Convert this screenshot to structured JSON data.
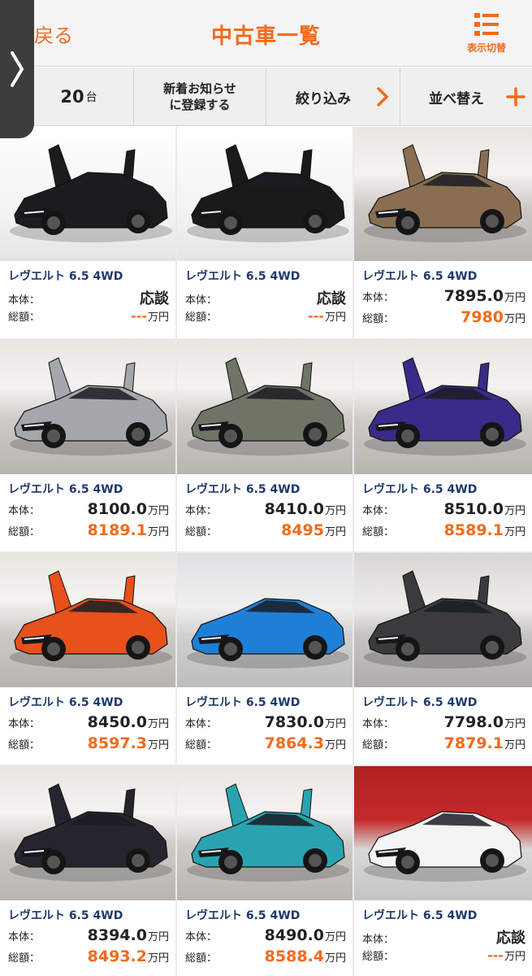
{
  "header": {
    "back_label": "戻る",
    "title": "中古車一覧",
    "view_toggle_label": "表示切替",
    "accent": "#f26a1b"
  },
  "toolbar": {
    "count_value": "20",
    "count_unit": "台",
    "notify_line1": "新着お知らせ",
    "notify_line2": "に登録する",
    "filter_label": "絞り込み",
    "sort_label": "並べ替え"
  },
  "labels": {
    "body": "本体：",
    "total": "総額：",
    "yen": "万円"
  },
  "cars": [
    {
      "model": "レヴエルト 6.5 4WD",
      "body_price": "応談",
      "total_price": "---",
      "color": "#1c1c1e",
      "bg": "white"
    },
    {
      "model": "レヴエルト 6.5 4WD",
      "body_price": "応談",
      "total_price": "---",
      "color": "#1a1a1a",
      "bg": "white"
    },
    {
      "model": "レヴエルト 6.5 4WD",
      "body_price": "7895.0",
      "total_price": "7980",
      "color": "#8a6e52",
      "bg": "showroom"
    },
    {
      "model": "レヴエルト 6.5 4WD",
      "body_price": "8100.0",
      "total_price": "8189.1",
      "color": "#a4a7ab",
      "bg": "showroom"
    },
    {
      "model": "レヴエルト 6.5 4WD",
      "body_price": "8410.0",
      "total_price": "8495",
      "color": "#6e7566",
      "bg": "showroom"
    },
    {
      "model": "レヴエルト 6.5 4WD",
      "body_price": "8510.0",
      "total_price": "8589.1",
      "color": "#3a2a8a",
      "bg": "showroom"
    },
    {
      "model": "レヴエルト 6.5 4WD",
      "body_price": "8450.0",
      "total_price": "8597.3",
      "color": "#e8501c",
      "bg": "showroom"
    },
    {
      "model": "レヴエルト 6.5 4WD",
      "body_price": "7830.0",
      "total_price": "7864.3",
      "color": "#1f7fd6",
      "bg": "blue-show"
    },
    {
      "model": "レヴエルト 6.5 4WD",
      "body_price": "7798.0",
      "total_price": "7879.1",
      "color": "#3b3b3e",
      "bg": "dark-wall"
    },
    {
      "model": "レヴエルト 6.5 4WD",
      "body_price": "8394.0",
      "total_price": "8493.2",
      "color": "#26252e",
      "bg": "showroom"
    },
    {
      "model": "レヴエルト 6.5 4WD",
      "body_price": "8490.0",
      "total_price": "8588.4",
      "color": "#2aa3b0",
      "bg": "showroom"
    },
    {
      "model": "レヴエルト 6.5 4WD",
      "body_price": "応談",
      "total_price": "---",
      "color": "#f4f4f4",
      "bg": "red-wall"
    }
  ]
}
